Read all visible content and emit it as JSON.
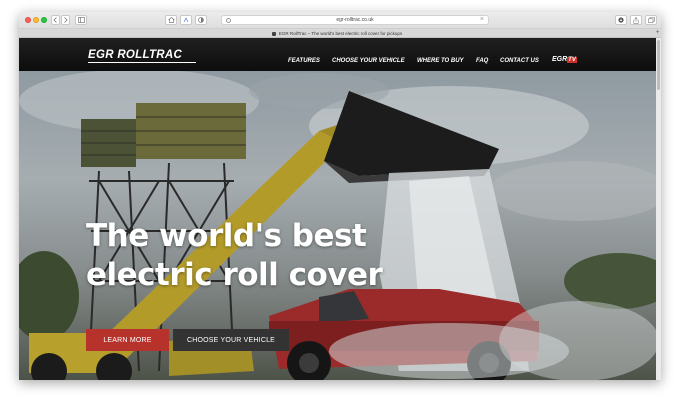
{
  "browser": {
    "address": "egr-rolltrac.co.uk",
    "tab_title": "EGR RollTrac – The world's best electric roll cover for pickups",
    "new_tab_symbol": "+"
  },
  "site": {
    "logo": "EGR ROLLTRAC",
    "nav": [
      "FEATURES",
      "CHOOSE YOUR VEHICLE",
      "WHERE TO BUY",
      "FAQ",
      "CONTACT US"
    ],
    "tv_prefix": "EGR",
    "tv_suffix": "TV"
  },
  "hero": {
    "title_line1": "The world's best",
    "title_line2": "electric roll cover",
    "cta_primary": "LEARN MORE",
    "cta_secondary": "CHOOSE YOUR VEHICLE"
  },
  "colors": {
    "accent": "#b8322c",
    "header_bg": "#141414",
    "button_dark": "#333333"
  }
}
